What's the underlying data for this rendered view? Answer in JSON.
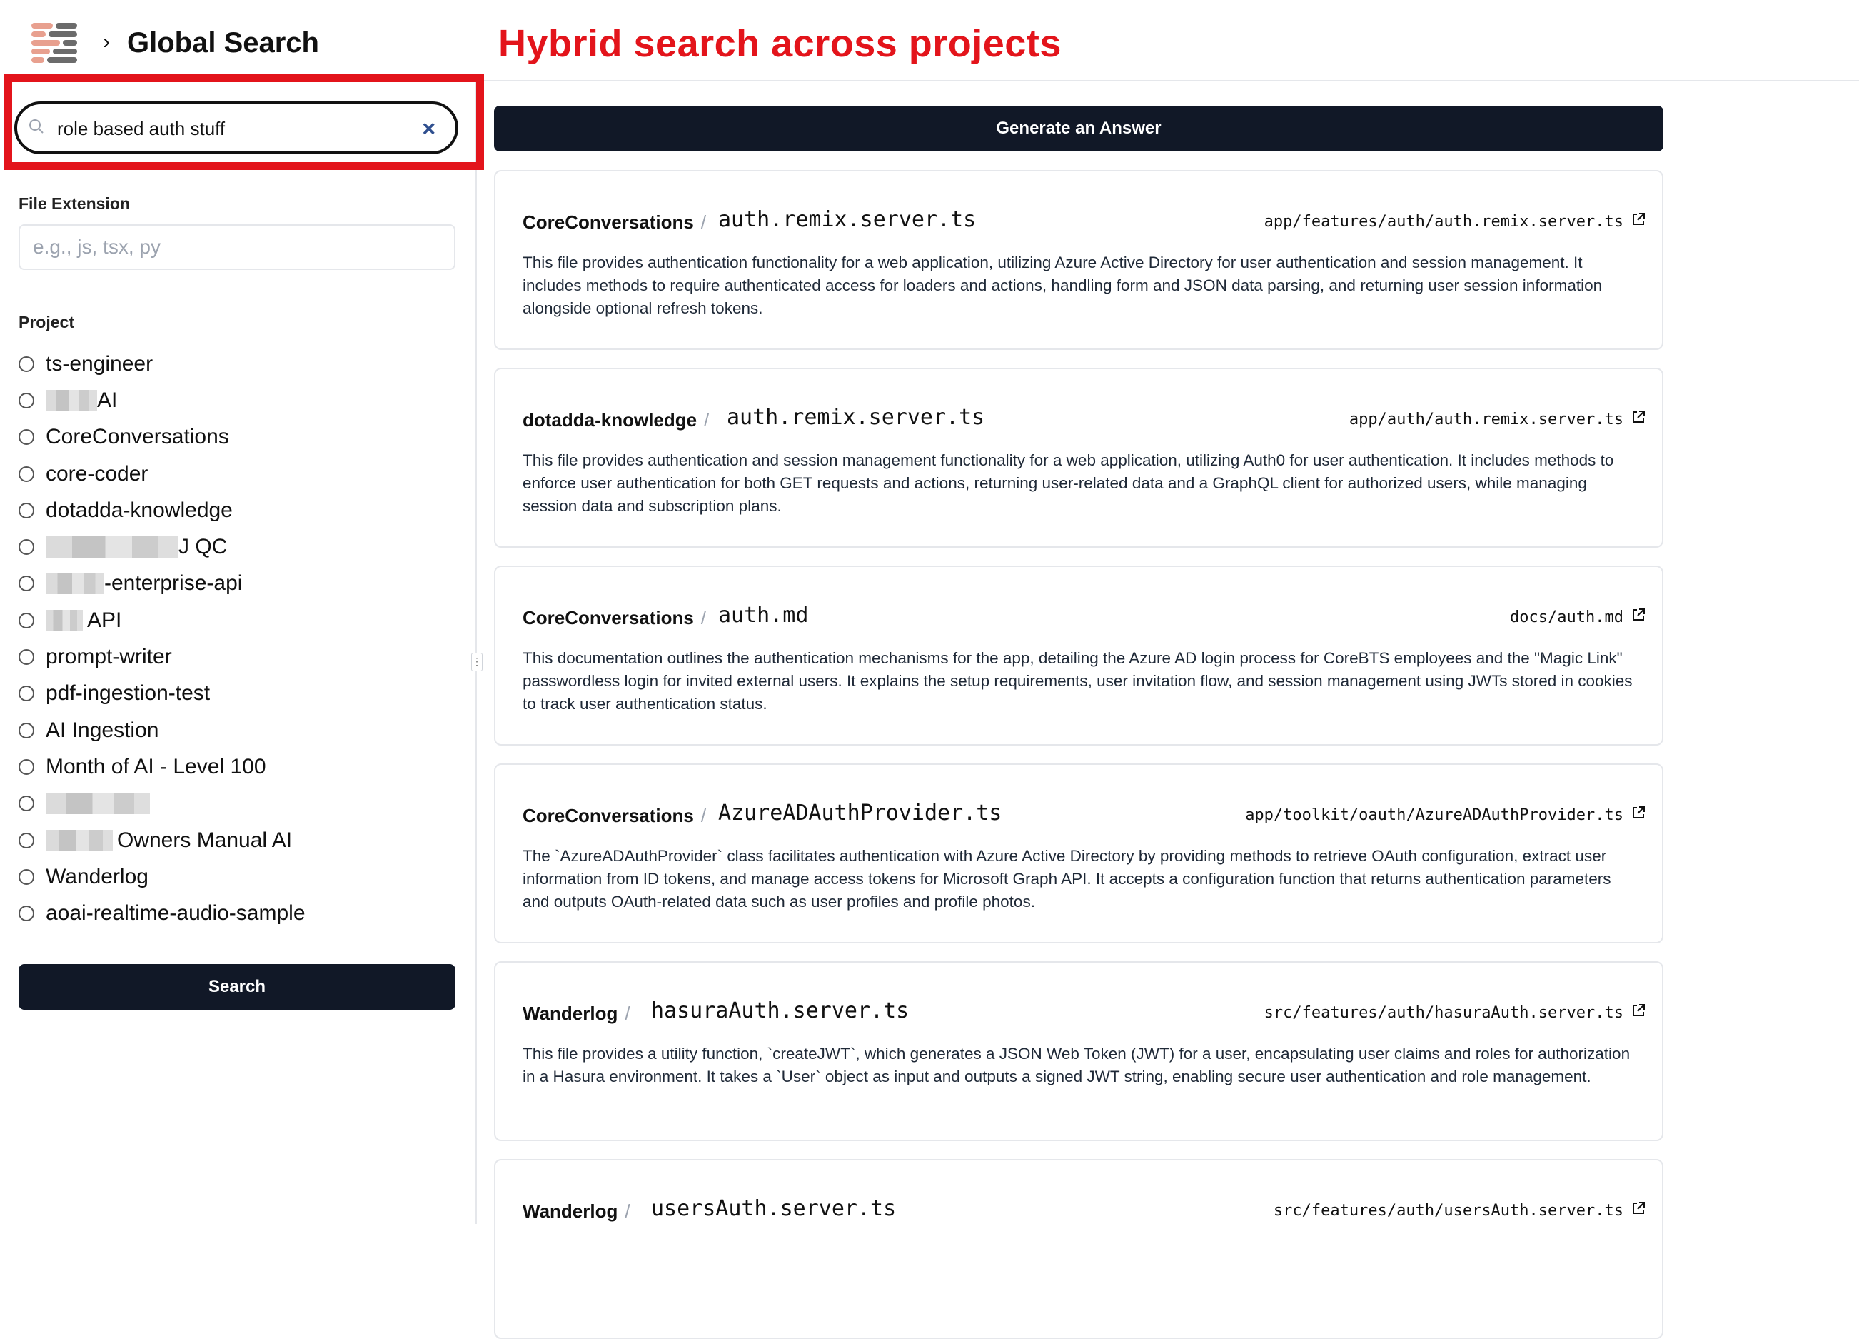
{
  "header": {
    "breadcrumb_separator": "›",
    "title": "Global Search",
    "annotation": "Hybrid search across projects"
  },
  "sidebar": {
    "search": {
      "value": "role based auth stuff",
      "clear_icon": "×"
    },
    "file_extension": {
      "label": "File Extension",
      "placeholder": "e.g., js, tsx, py"
    },
    "project": {
      "label": "Project",
      "items": [
        {
          "label": "ts-engineer",
          "selected": false
        },
        {
          "label": "AI",
          "selected": false,
          "redacted_prefix": true
        },
        {
          "label": "CoreConversations",
          "selected": false
        },
        {
          "label": "core-coder",
          "selected": false
        },
        {
          "label": "dotadda-knowledge",
          "selected": false
        },
        {
          "label": "J QC",
          "selected": false,
          "redacted_prefix": true
        },
        {
          "label": "-enterprise-api",
          "selected": false,
          "redacted_prefix": true
        },
        {
          "label": "API",
          "selected": false,
          "redacted_prefix": true
        },
        {
          "label": "prompt-writer",
          "selected": false
        },
        {
          "label": "pdf-ingestion-test",
          "selected": false
        },
        {
          "label": "AI Ingestion",
          "selected": false
        },
        {
          "label": "Month of AI - Level 100",
          "selected": false
        },
        {
          "label": "",
          "selected": false,
          "redacted_prefix": true
        },
        {
          "label": "Owners Manual AI",
          "selected": false,
          "redacted_prefix": true
        },
        {
          "label": "Wanderlog",
          "selected": false
        },
        {
          "label": "aoai-realtime-audio-sample",
          "selected": false
        }
      ]
    },
    "search_button": "Search"
  },
  "main": {
    "generate_button": "Generate an Answer",
    "results": [
      {
        "project": "CoreConversations",
        "separator": "/",
        "filename": "auth.remix.server.ts",
        "path": "app/features/auth/auth.remix.server.ts",
        "description": "This file provides authentication functionality for a web application, utilizing Azure Active Directory for user authentication and session management. It includes methods to require authenticated access for loaders and actions, handling form and JSON data parsing, and returning user session information alongside optional refresh tokens."
      },
      {
        "project": "dotadda-knowledge",
        "separator": "/",
        "filename": "auth.remix.server.ts",
        "path": "app/auth/auth.remix.server.ts",
        "description": "This file provides authentication and session management functionality for a web application, utilizing Auth0 for user authentication. It includes methods to enforce user authentication for both GET requests and actions, returning user-related data and a GraphQL client for authorized users, while managing session data and subscription plans."
      },
      {
        "project": "CoreConversations",
        "separator": "/",
        "filename": "auth.md",
        "path": "docs/auth.md",
        "description": "This documentation outlines the authentication mechanisms for the app, detailing the Azure AD login process for CoreBTS employees and the \"Magic Link\" passwordless login for invited external users. It explains the setup requirements, user invitation flow, and session management using JWTs stored in cookies to track user authentication status."
      },
      {
        "project": "CoreConversations",
        "separator": "/",
        "filename": "AzureADAuthProvider.ts",
        "path": "app/toolkit/oauth/AzureADAuthProvider.ts",
        "description": "The `AzureADAuthProvider` class facilitates authentication with Azure Active Directory by providing methods to retrieve OAuth configuration, extract user information from ID tokens, and manage access tokens for Microsoft Graph API. It accepts a configuration function that returns authentication parameters and outputs OAuth-related data such as user profiles and profile photos."
      },
      {
        "project": "Wanderlog",
        "separator": "/",
        "filename": "hasuraAuth.server.ts",
        "path": "src/features/auth/hasuraAuth.server.ts",
        "description": "This file provides a utility function, `createJWT`, which generates a JSON Web Token (JWT) for a user, encapsulating user claims and roles for authorization in a Hasura environment. It takes a `User` object as input and outputs a signed JWT string, enabling secure user authentication and role management."
      },
      {
        "project": "Wanderlog",
        "separator": "/",
        "filename": "usersAuth.server.ts",
        "path": "src/features/auth/usersAuth.server.ts",
        "description": ""
      }
    ]
  },
  "colors": {
    "accent_annotation": "#e3141b",
    "button_dark": "#111827",
    "clear_icon": "#2f4f8f"
  }
}
